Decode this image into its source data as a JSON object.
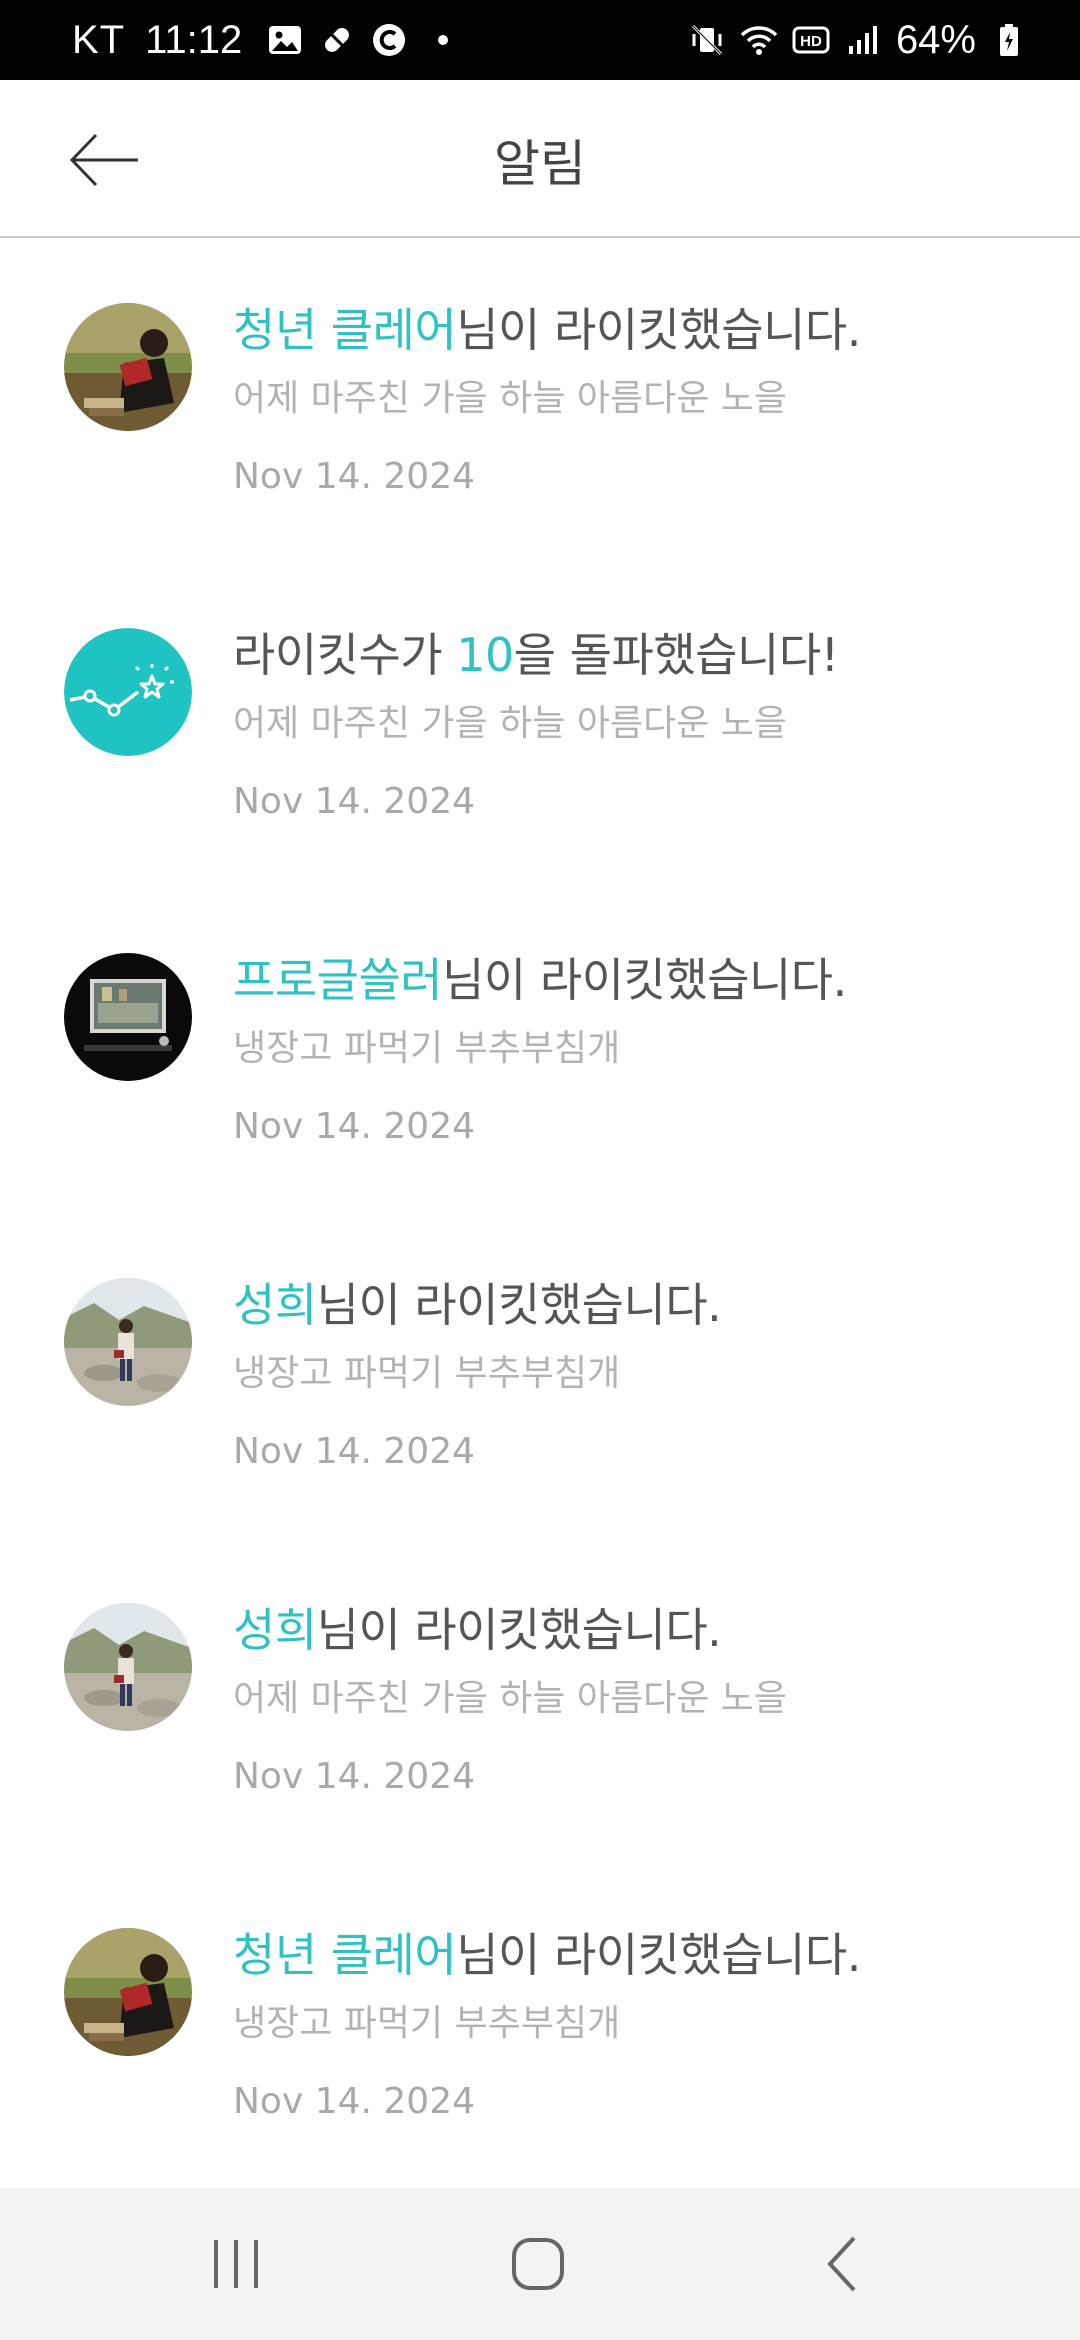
{
  "status_bar": {
    "carrier": "KT",
    "time": "11:12",
    "battery": "64%",
    "left_icons": [
      "image-icon",
      "pill-icon",
      "c-circle-icon"
    ],
    "right_icons": [
      "mute-vibrate-icon",
      "wifi-icon",
      "hd-icon",
      "signal-icon",
      "battery-charging-icon"
    ]
  },
  "header": {
    "title": "알림",
    "back_icon": "arrow-left-icon"
  },
  "colors": {
    "accent": "#2fc1c4",
    "text": "#555555",
    "subtext": "#b3b3b3"
  },
  "notifications": [
    {
      "highlight": "청년 클레어",
      "rest": "님이 라이킷했습니다.",
      "subtitle": "어제 마주친 가을 하늘 아름다운 노을",
      "date": "Nov 14. 2024",
      "avatar": "reader-photo"
    },
    {
      "prefix": "라이킷수가 ",
      "highlight": "10",
      "rest": "을 돌파했습니다!",
      "subtitle": "어제 마주친 가을 하늘 아름다운 노을",
      "date": "Nov 14. 2024",
      "avatar": "milestone-star-icon"
    },
    {
      "highlight": "프로글쓸러",
      "rest": "님이 라이킷했습니다.",
      "subtitle": "냉장고 파먹기 부추부침개",
      "date": "Nov 14. 2024",
      "avatar": "lecture-photo"
    },
    {
      "highlight": "성희",
      "rest": "님이 라이킷했습니다.",
      "subtitle": "냉장고 파먹기 부추부침개",
      "date": "Nov 14. 2024",
      "avatar": "stream-photo"
    },
    {
      "highlight": "성희",
      "rest": "님이 라이킷했습니다.",
      "subtitle": "어제 마주친 가을 하늘 아름다운 노을",
      "date": "Nov 14. 2024",
      "avatar": "stream-photo"
    },
    {
      "highlight": "청년 클레어",
      "rest": "님이 라이킷했습니다.",
      "subtitle": "냉장고 파먹기 부추부침개",
      "date": "Nov 14. 2024",
      "avatar": "reader-photo"
    }
  ],
  "nav_bar": {
    "recents_icon": "recents-icon",
    "home_icon": "home-icon",
    "back_icon": "back-chevron-icon"
  }
}
